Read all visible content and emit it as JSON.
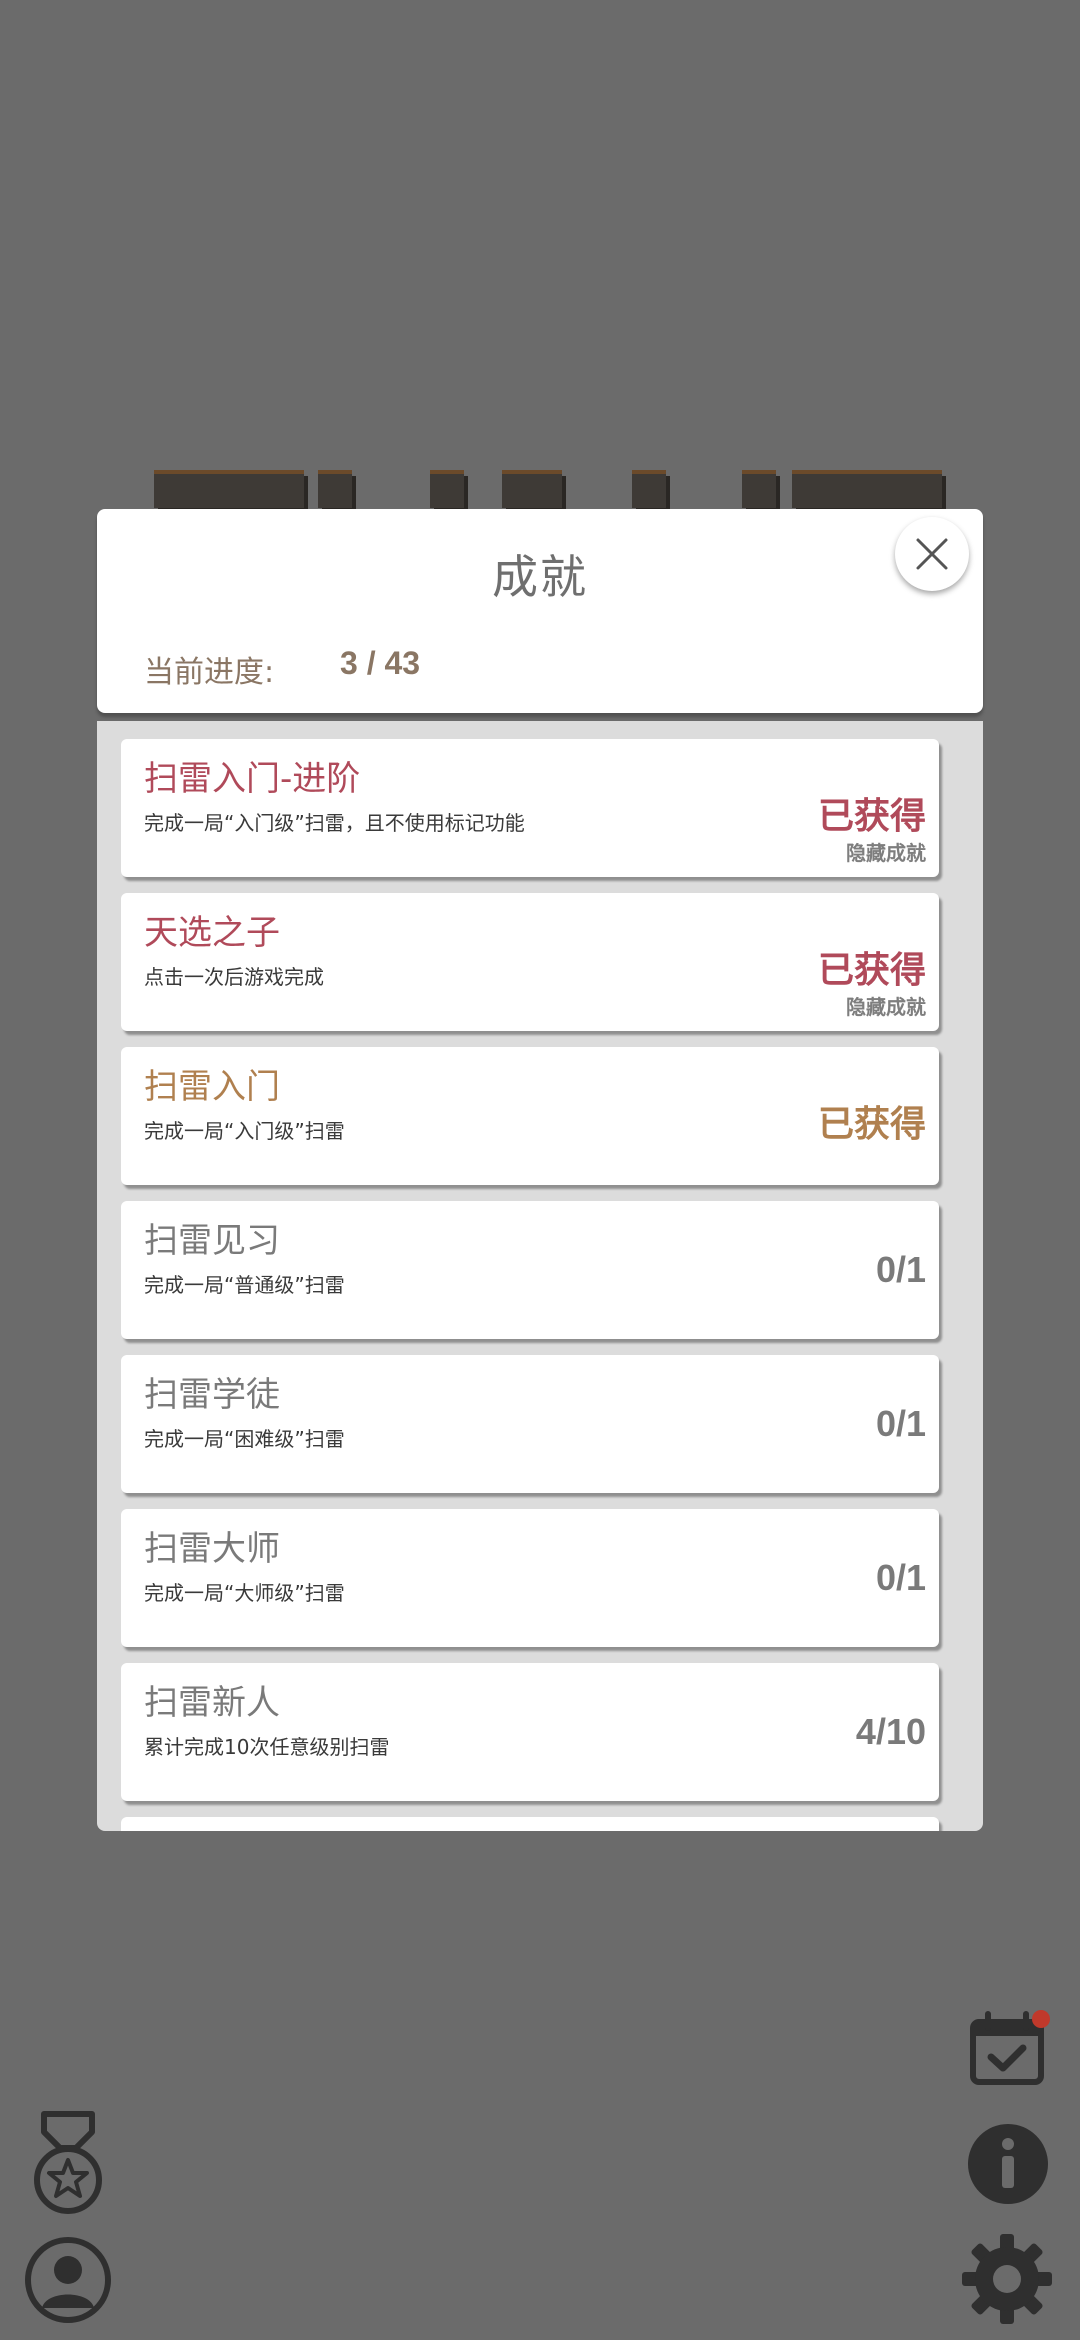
{
  "modal": {
    "title": "成就",
    "progress_label": "当前进度:",
    "progress_value": "3 / 43"
  },
  "achievements": [
    {
      "title": "扫雷入门-进阶",
      "desc": "完成一局“入门级”扫雷，且不使用标记功能",
      "status": "已获得",
      "sub": "隐藏成就",
      "color": "#b04a5a"
    },
    {
      "title": "天选之子",
      "desc": "点击一次后游戏完成",
      "status": "已获得",
      "sub": "隐藏成就",
      "color": "#b04a5a"
    },
    {
      "title": "扫雷入门",
      "desc": "完成一局“入门级”扫雷",
      "status": "已获得",
      "sub": "",
      "color": "#b0804f"
    },
    {
      "title": "扫雷见习",
      "desc": "完成一局“普通级”扫雷",
      "status": "0/1",
      "sub": "",
      "color": "#7a7a7a"
    },
    {
      "title": "扫雷学徒",
      "desc": "完成一局“困难级”扫雷",
      "status": "0/1",
      "sub": "",
      "color": "#7a7a7a"
    },
    {
      "title": "扫雷大师",
      "desc": "完成一局“大师级”扫雷",
      "status": "0/1",
      "sub": "",
      "color": "#7a7a7a"
    },
    {
      "title": "扫雷新人",
      "desc": "累计完成10次任意级别扫雷",
      "status": "4/10",
      "sub": "",
      "color": "#7a7a7a"
    }
  ],
  "icons": {
    "close": "close-icon",
    "calendar": "calendar-check-icon",
    "info": "info-icon",
    "settings": "gear-icon",
    "medal": "medal-icon",
    "profile": "user-icon"
  },
  "colors": {
    "backdrop": "#6b6b6b",
    "earned_red": "#b04a5a",
    "earned_gold": "#b0804f",
    "pending_gray": "#7a7a7a",
    "notification_dot": "#c0392b"
  }
}
